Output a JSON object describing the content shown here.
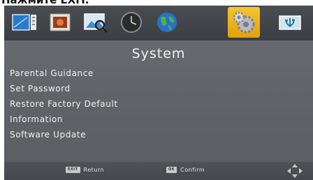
{
  "top_caption": "Нажмите EXIT.",
  "icon_bar": {
    "tabs": [
      {
        "icon": "channel-list-icon",
        "active": false
      },
      {
        "icon": "picture-icon",
        "active": false
      },
      {
        "icon": "channel-search-icon",
        "active": false
      },
      {
        "icon": "clock-icon",
        "active": false
      },
      {
        "icon": "globe-icon",
        "active": false
      },
      {
        "icon": "gears-icon",
        "active": true
      },
      {
        "icon": "usb-icon",
        "active": false
      }
    ],
    "active_color": "#f2b81e"
  },
  "page": {
    "title": "System"
  },
  "menu": {
    "items": [
      "Parental Guidance",
      "Set Password",
      "Restore Factory Default",
      "Information",
      "Software Update"
    ]
  },
  "footer": {
    "return_key": "EXIT",
    "return_label": "Return",
    "confirm_key": "OK",
    "confirm_label": "Confirm",
    "nav_icon": "navigation-arrows-icon"
  }
}
